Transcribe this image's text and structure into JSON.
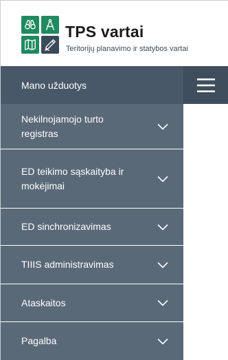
{
  "header": {
    "title": "TPS vartai",
    "subtitle": "Teritorijų planavimo ir statybos vartai",
    "logo_icons": [
      "binoculars-icon",
      "compass-icon",
      "map-icon",
      "pen-icon"
    ],
    "colors": {
      "logo_green": "#1f8a5f",
      "logo_dark": "#3a4a58"
    }
  },
  "topbar": {
    "my_tasks_label": "Mano užduotys",
    "menu_toggle_icon": "hamburger-icon",
    "colors": {
      "bar": "#485868",
      "toggle": "#3f4e5c"
    }
  },
  "menu": {
    "colors": {
      "background": "#5a6978",
      "separator": "#ffffff",
      "text": "#ffffff"
    },
    "items": [
      {
        "label": "Nekilnojamojo turto registras",
        "icon": "chevron-down-icon"
      },
      {
        "label": "ED teikimo sąskaityba ir mokėjimai",
        "icon": "chevron-down-icon"
      },
      {
        "label": "ED sinchronizavimas",
        "icon": "chevron-down-icon"
      },
      {
        "label": "TIIIS administravimas",
        "icon": "chevron-down-icon"
      },
      {
        "label": "Ataskaitos",
        "icon": "chevron-down-icon"
      },
      {
        "label": "Pagalba",
        "icon": "chevron-down-icon"
      }
    ]
  }
}
